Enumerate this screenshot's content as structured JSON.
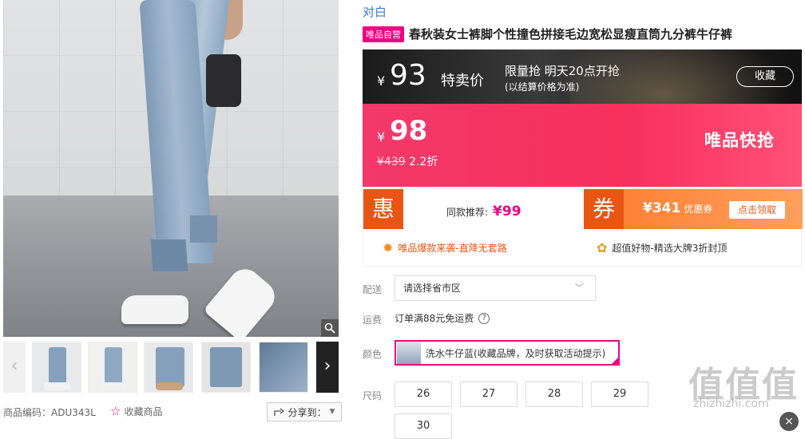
{
  "gallery": {
    "zoom_icon": "magnifier-icon",
    "thumb_count": 5,
    "prev_arrow": "‹",
    "next_arrow": "›"
  },
  "product_meta": {
    "code": "商品编码：ADU343L",
    "favorite_label": "收藏商品",
    "share_label": "分享到："
  },
  "brand": "对白",
  "self_operated_tag": "唯品自营",
  "title": "春秋装女士裤脚个性撞色拼接毛边宽松显瘦直筒九分裤牛仔裤",
  "special_price": {
    "currency": "¥",
    "value": "93",
    "label": "特卖价",
    "line1": "限量抢 明天20点开抢",
    "line2": "(以结算价格为准)",
    "favorite_button": "收藏"
  },
  "flash_price": {
    "currency": "¥",
    "value": "98",
    "original": "¥439",
    "discount": "2.2折",
    "label": "唯品快抢"
  },
  "promo": {
    "hui_badge": "惠",
    "same_label": "同款推荐:",
    "same_price": "¥99",
    "coupon_badge": "券",
    "coupon_value": "¥341",
    "coupon_suffix": "优惠券",
    "coupon_button": "点击领取",
    "line1": "唯品爆款来袭-直降无套路",
    "line2": "超值好物-精选大牌3折封顶"
  },
  "delivery": {
    "label": "配送",
    "placeholder": "请选择省市区"
  },
  "shipping": {
    "label": "运费",
    "text": "订单满88元免运费",
    "help": "?"
  },
  "color": {
    "label": "颜色",
    "selected": "洗水牛仔蓝(收藏品牌，及时获取活动提示)"
  },
  "size": {
    "label": "尺码",
    "options": [
      "26",
      "27",
      "28",
      "29",
      "30"
    ]
  },
  "watermark": {
    "text": "值值值",
    "url": "zhizhizhi.com",
    "close": "×"
  },
  "colors": {
    "accent": "#f10180",
    "orange": "#ea5514",
    "link": "#3b7bd6"
  }
}
